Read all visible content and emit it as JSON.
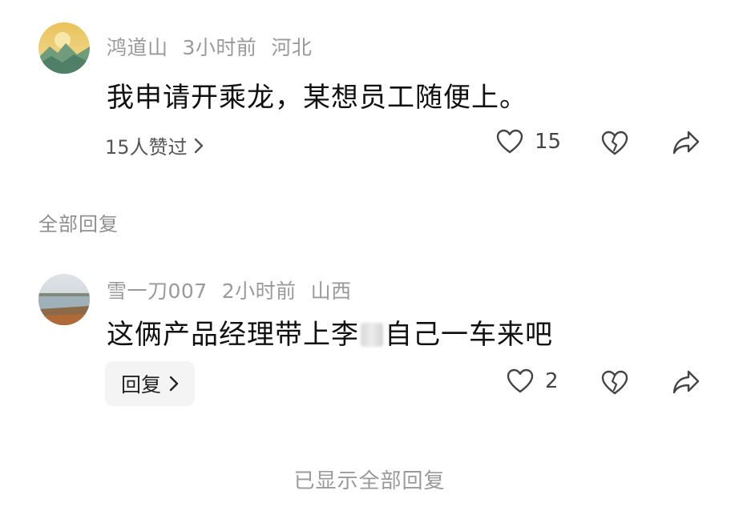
{
  "comment1": {
    "username": "鸿道山",
    "time": "3小时前",
    "location": "河北",
    "text": "我申请开乘龙，某想员工随便上。",
    "likes_summary": "15人赞过",
    "like_count": "15"
  },
  "all_replies_label": "全部回复",
  "comment2": {
    "username": "雪一刀007",
    "time": "2小时前",
    "location": "山西",
    "text_before": "这俩产品经理带上李",
    "text_after": "自己一车来吧",
    "reply_label": "回复",
    "like_count": "2"
  },
  "footer": "已显示全部回复",
  "icons": {
    "like": "heart-icon",
    "dislike": "broken-heart-icon",
    "share": "share-arrow-icon",
    "chevron": "chevron-right-icon"
  }
}
